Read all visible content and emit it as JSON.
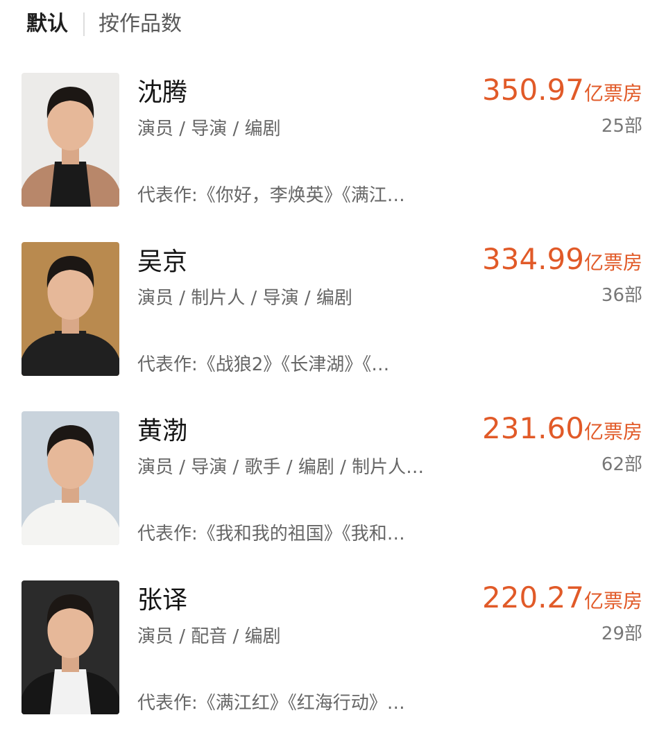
{
  "sort": {
    "tabs": [
      {
        "label": "默认",
        "active": true
      },
      {
        "label": "按作品数",
        "active": false
      }
    ]
  },
  "actors": [
    {
      "name": "沈腾",
      "roles": "演员 / 导演 / 编剧",
      "works": "代表作:《你好，李焕英》《满江…",
      "box_office": "350.97",
      "box_office_unit": "亿票房",
      "film_count": "25部",
      "avatar": {
        "icon": "person-portrait-icon",
        "bg": "#ecebe9",
        "shirt": "#1a1a1a",
        "jacket": "#b8876a"
      }
    },
    {
      "name": "吴京",
      "roles": "演员 / 制片人 / 导演 / 编剧",
      "works": "代表作:《战狼2》《长津湖》《…",
      "box_office": "334.99",
      "box_office_unit": "亿票房",
      "film_count": "36部",
      "avatar": {
        "icon": "person-portrait-icon",
        "bg": "#b98a4f",
        "shirt": "#202020",
        "jacket": "#202020"
      }
    },
    {
      "name": "黄渤",
      "roles": "演员 / 导演 / 歌手 / 编剧 / 制片人…",
      "works": "代表作:《我和我的祖国》《我和…",
      "box_office": "231.60",
      "box_office_unit": "亿票房",
      "film_count": "62部",
      "avatar": {
        "icon": "person-portrait-icon",
        "bg": "#c9d3dc",
        "shirt": "#f4f4f2",
        "jacket": "#f4f4f2"
      }
    },
    {
      "name": "张译",
      "roles": "演员 / 配音 / 编剧",
      "works": "代表作:《满江红》《红海行动》…",
      "box_office": "220.27",
      "box_office_unit": "亿票房",
      "film_count": "29部",
      "avatar": {
        "icon": "person-portrait-icon",
        "bg": "#2b2b2b",
        "shirt": "#f2f2f2",
        "jacket": "#161616"
      }
    }
  ]
}
